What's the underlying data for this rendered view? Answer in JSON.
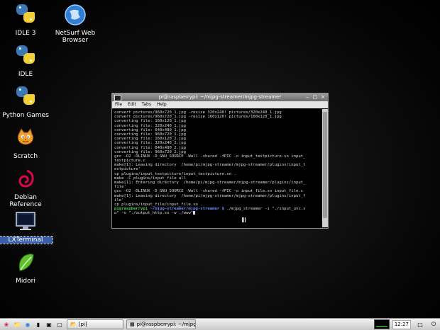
{
  "desktop": {
    "icons": [
      {
        "label": "IDLE 3"
      },
      {
        "label": "NetSurf Web Browser"
      },
      {
        "label": "IDLE"
      },
      {
        "label": "Python Games"
      },
      {
        "label": "Scratch"
      },
      {
        "label": "Debian Reference"
      },
      {
        "label": "LXTerminal"
      },
      {
        "label": "Midori"
      }
    ]
  },
  "terminal": {
    "title": "pi@raspberrypi: ~/mjpg-streamer/mjpg-streamer",
    "menu": [
      "File",
      "Edit",
      "Tabs",
      "Help"
    ],
    "lines": [
      "convert pictures/960x720_1.jpg -resize 320x240! pictures/320x240_1.jpg",
      "convert pictures/960x720_1.jpg -resize 160x120! pictures/160x120_1.jpg",
      "converting file: 160x120_1.jpg",
      "converting file: 320x240_1.jpg",
      "converting file: 640x480_1.jpg",
      "converting file: 960x720_1.jpg",
      "converting file: 160x120_2.jpg",
      "converting file: 320x240_2.jpg",
      "converting file: 640x480_2.jpg",
      "converting file: 960x720_2.jpg",
      "gcc -O2 -DLINUX -D_GNU_SOURCE -Wall -shared -fPIC -o input_testpicture.so input_",
      "testpicture.c",
      "make[1]: Leaving directory `/home/pi/mjpg-streamer/mjpg-streamer/plugins/input_t",
      "estpicture'",
      "cp plugins/input_testpicture/input_testpicture.so .",
      "make -C plugins/input_file all",
      "make[1]: Entering directory `/home/pi/mjpg-streamer/mjpg-streamer/plugins/input_",
      "file'",
      "gcc -O2 -DLINUX -D_GNU_SOURCE -Wall -shared -fPIC -o input_file.so input_file.c",
      "make[1]: Leaving directory `/home/pi/mjpg-streamer/mjpg-streamer/plugins/input_f",
      "ile'",
      "cp plugins/input_file/input_file.so ."
    ],
    "prompt_user": "pi@raspberrypi",
    "prompt_path": " ~/mjpg-streamer/mjpg-streamer $",
    "command_1": " ./mjpg_streamer -i \"./input_uvc.s",
    "command_2": "o\" -o \"./output_http.so -w ./www\""
  },
  "taskbar": {
    "tasks": [
      "[pi]",
      "pi@raspberrypi: ~/mjpg..."
    ],
    "clock": "12:27"
  },
  "colors": {
    "prompt_user": "#4bd34b",
    "prompt_path": "#6f8fff",
    "selection": "#3a5fa8"
  }
}
